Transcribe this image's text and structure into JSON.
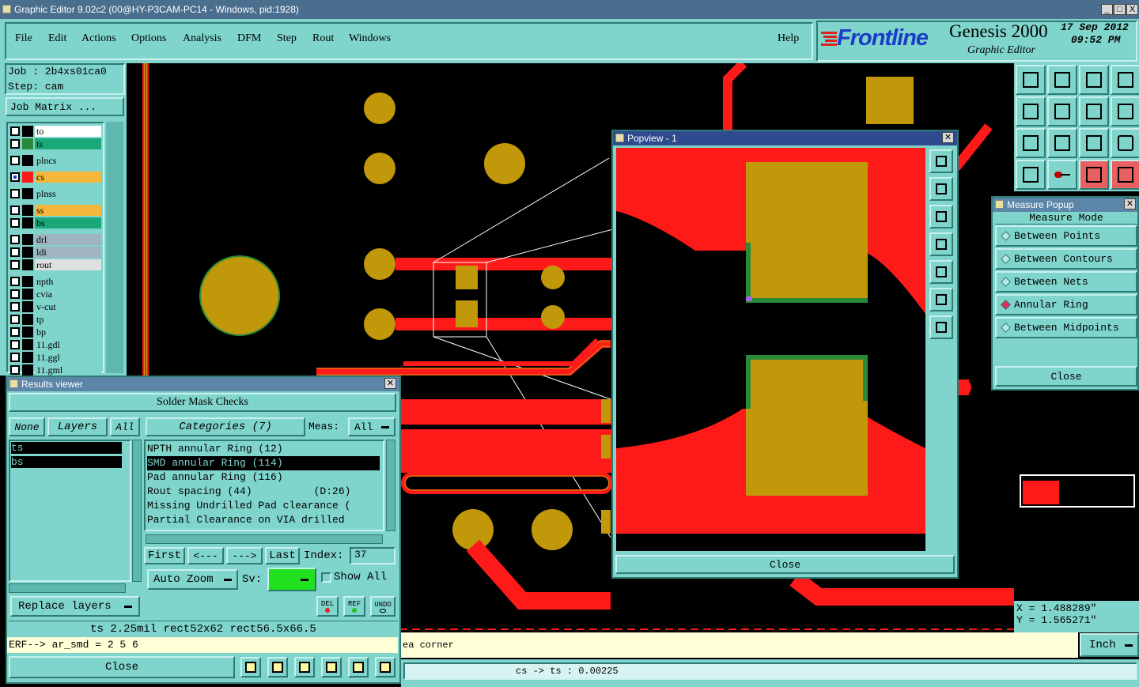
{
  "window": {
    "title": "Graphic Editor 9.02c2 (00@HY-P3CAM-PC14 - Windows, pid:1928)",
    "controls": [
      "_",
      "□",
      "X"
    ]
  },
  "menu": {
    "items": [
      "File",
      "Edit",
      "Actions",
      "Options",
      "Analysis",
      "DFM",
      "Step",
      "Rout",
      "Windows"
    ],
    "help": "Help"
  },
  "brand": {
    "logo": "Frontline",
    "product": "Genesis 2000",
    "subtitle": "Graphic Editor",
    "date": "17 Sep 2012",
    "time": "09:52 PM"
  },
  "job": {
    "job_label": "Job : 2b4xs01ca0",
    "step_label": "Step: cam",
    "matrix_button": "Job Matrix ..."
  },
  "layers": [
    {
      "name": "to",
      "swatch": "#000000",
      "bg": "#ffffff",
      "checked": false
    },
    {
      "name": "ts",
      "swatch": "#2a8a3a",
      "bg": "#1aa878",
      "checked": false
    },
    {
      "name": "plncs",
      "swatch": "",
      "bg": "#7fd4cc",
      "checked": false
    },
    {
      "name": "cs",
      "swatch": "#ff1a1a",
      "bg": "#f5b83a",
      "checked": true
    },
    {
      "name": "plnss",
      "swatch": "",
      "bg": "#7fd4cc",
      "checked": false
    },
    {
      "name": "ss",
      "swatch": "",
      "bg": "#f5b83a",
      "checked": false
    },
    {
      "name": "bs",
      "swatch": "",
      "bg": "#1aa878",
      "checked": false
    },
    {
      "name": "drl",
      "swatch": "",
      "bg": "#a0b4c0",
      "checked": false
    },
    {
      "name": "ldi",
      "swatch": "",
      "bg": "#a0b4c0",
      "checked": false
    },
    {
      "name": "rout",
      "swatch": "",
      "bg": "#e0e0e0",
      "checked": false
    },
    {
      "name": "npth",
      "swatch": "",
      "bg": "#7fd4cc",
      "checked": false
    },
    {
      "name": "cvia",
      "swatch": "",
      "bg": "#7fd4cc",
      "checked": false
    },
    {
      "name": "v-cut",
      "swatch": "",
      "bg": "#7fd4cc",
      "checked": false
    },
    {
      "name": "tp",
      "swatch": "",
      "bg": "#7fd4cc",
      "checked": false
    },
    {
      "name": "bp",
      "swatch": "",
      "bg": "#7fd4cc",
      "checked": false
    },
    {
      "name": "11.gdl",
      "swatch": "",
      "bg": "#7fd4cc",
      "checked": false
    },
    {
      "name": "11.ggl",
      "swatch": "",
      "bg": "#7fd4cc",
      "checked": false
    },
    {
      "name": "11.gml",
      "swatch": "",
      "bg": "#7fd4cc",
      "checked": false
    }
  ],
  "results_viewer": {
    "title": "Results viewer",
    "header": "Solder Mask Checks",
    "none_btn": "None",
    "layers_btn": "Layers",
    "all_btn": "All",
    "categories_btn": "Categories (7)",
    "meas_label": "Meas:",
    "meas_value": "All",
    "layer_list": [
      "ts",
      "bs"
    ],
    "categories": [
      "NPTH annular Ring (12)",
      "SMD annular Ring (114)",
      "Pad annular Ring (116)",
      "Rout spacing (44)          (D:26)",
      "Missing Undrilled Pad clearance (",
      "Partial Clearance on VIA drilled"
    ],
    "selected_category": 1,
    "first_btn": "First",
    "prev_btn": "<---",
    "next_btn": "--->",
    "last_btn": "Last",
    "index_label": "Index:",
    "index_value": "37",
    "auto_zoom": "Auto Zoom",
    "sv_label": "Sv:",
    "show_all": "Show All",
    "replace_layers": "Replace layers",
    "del_btn": "DEL",
    "ref_btn": "REF",
    "undo_btn": "UNDO",
    "info_line": "ts 2.25mil   rect52x62   rect56.5x66.5",
    "erf_line": "ERF--> ar_smd = 2 5 6",
    "close_btn": "Close"
  },
  "popview": {
    "title": "Popview - 1",
    "close_btn": "Close"
  },
  "measure": {
    "title": "Measure Popup",
    "mode_label": "Measure Mode",
    "options": [
      "Between Points",
      "Between Contours",
      "Between Nets",
      "Annular Ring",
      "Between Midpoints"
    ],
    "selected": 3,
    "close_btn": "Close"
  },
  "status": {
    "x_label": "X = 1.488289\"",
    "y_label": "Y = 1.565271\"",
    "unit": "Inch",
    "message": "ea corner",
    "measure_result": "cs -> ts : 0.00225"
  },
  "colors": {
    "teal": "#7fd4cc",
    "copper": "#ff1a1a",
    "pad": "#c0980a",
    "mask": "#2a8a3a"
  }
}
